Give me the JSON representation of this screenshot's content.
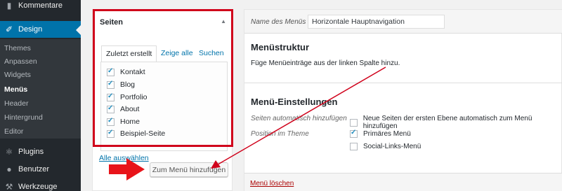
{
  "sidebar": {
    "top_item": "Kommentare",
    "current_item": "Design",
    "submenu": [
      "Themes",
      "Anpassen",
      "Widgets",
      "Menüs",
      "Header",
      "Hintergrund",
      "Editor"
    ],
    "current_submenu": "Menüs",
    "bottom_items": [
      "Plugins",
      "Benutzer",
      "Werkzeuge"
    ]
  },
  "pages_box": {
    "title": "Seiten",
    "tabs": [
      "Zuletzt erstellt",
      "Zeige alle",
      "Suchen"
    ],
    "items": [
      {
        "label": "Kontakt",
        "checked": true
      },
      {
        "label": "Blog",
        "checked": true
      },
      {
        "label": "Portfolio",
        "checked": true
      },
      {
        "label": "About",
        "checked": true
      },
      {
        "label": "Home",
        "checked": true
      },
      {
        "label": "Beispiel-Seite",
        "checked": true
      }
    ],
    "select_all": "Alle auswählen",
    "add_button": "Zum Menü hinzufügen"
  },
  "menu_editor": {
    "name_label": "Name des Menüs",
    "name_value": "Horizontale Hauptnavigation",
    "structure_heading": "Menüstruktur",
    "structure_hint": "Füge Menüeinträge aus der linken Spalte hinzu.",
    "settings_heading": "Menü-Einstellungen",
    "auto_add_label": "Seiten automatisch hinzufügen",
    "auto_add_option": "Neue Seiten der ersten Ebene automatisch zum Menü hinzufügen",
    "auto_add_checked": false,
    "position_label": "Position im Theme",
    "locations": [
      {
        "label": "Primäres Menü",
        "checked": true
      },
      {
        "label": "Social-Links-Menü",
        "checked": false
      }
    ],
    "delete_link": "Menü löschen"
  },
  "colors": {
    "highlight": "#d0021b",
    "admin_bar": "#23282d",
    "accent": "#0073aa"
  }
}
